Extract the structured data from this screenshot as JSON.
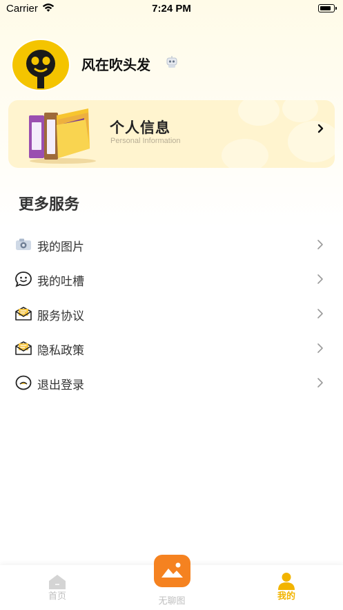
{
  "status_bar": {
    "carrier": "Carrier",
    "time": "7:24 PM"
  },
  "profile": {
    "username": "风在吹头发",
    "badge_icon": "robot-badge-icon",
    "avatar_icon": "face-avatar-icon"
  },
  "info_card": {
    "title": "个人信息",
    "subtitle": "Personal Information",
    "icon": "books-icon"
  },
  "section": {
    "title": "更多服务"
  },
  "menu": [
    {
      "label": "我的图片",
      "icon": "camera-icon"
    },
    {
      "label": "我的吐槽",
      "icon": "chat-face-icon"
    },
    {
      "label": "服务协议",
      "icon": "envelope-doc-icon"
    },
    {
      "label": "隐私政策",
      "icon": "envelope-doc-icon"
    },
    {
      "label": "退出登录",
      "icon": "logout-face-icon"
    }
  ],
  "tabs": [
    {
      "label": "首页",
      "icon": "home-icon",
      "active": false
    },
    {
      "label": "无聊图",
      "icon": "image-icon",
      "active": false
    },
    {
      "label": "我的",
      "icon": "person-icon",
      "active": true
    }
  ],
  "colors": {
    "accent": "#f2b400",
    "card_bg": "#fff4cf",
    "center_button": "#f58220",
    "tab_inactive": "#bfbfbf"
  }
}
